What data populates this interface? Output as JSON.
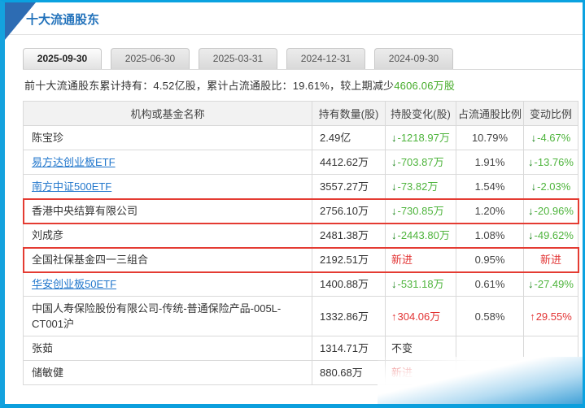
{
  "panel": {
    "title": "十大流通股东"
  },
  "tabs": [
    {
      "label": "2025-09-30",
      "active": true
    },
    {
      "label": "2025-06-30",
      "active": false
    },
    {
      "label": "2025-03-31",
      "active": false
    },
    {
      "label": "2024-12-31",
      "active": false
    },
    {
      "label": "2024-09-30",
      "active": false
    }
  ],
  "summary": {
    "label_holding": "前十大流通股东累计持有：",
    "holding_value": "4.52亿股",
    "label_ratio": "，累计占流通股比：",
    "ratio_value": "19.61%",
    "label_change": "，较上期减少",
    "change_value": "4606.06万股"
  },
  "table": {
    "headers": [
      "机构或基金名称",
      "持有数量(股)",
      "持股变化(股)",
      "占流通股比例",
      "变动比例"
    ],
    "rows": [
      {
        "name": "陈宝珍",
        "is_link": false,
        "quantity": "2.49亿",
        "change": "-1218.97万",
        "change_dir": "down",
        "ratio": "10.79%",
        "variation": "-4.67%",
        "variation_dir": "down",
        "highlighted": false
      },
      {
        "name": "易方达创业板ETF",
        "is_link": true,
        "quantity": "4412.62万",
        "change": "-703.87万",
        "change_dir": "down",
        "ratio": "1.91%",
        "variation": "-13.76%",
        "variation_dir": "down",
        "highlighted": false
      },
      {
        "name": "南方中证500ETF",
        "is_link": true,
        "quantity": "3557.27万",
        "change": "-73.82万",
        "change_dir": "down",
        "ratio": "1.54%",
        "variation": "-2.03%",
        "variation_dir": "down",
        "highlighted": false
      },
      {
        "name": "香港中央结算有限公司",
        "is_link": false,
        "quantity": "2756.10万",
        "change": "-730.85万",
        "change_dir": "down",
        "ratio": "1.20%",
        "variation": "-20.96%",
        "variation_dir": "down",
        "highlighted": true
      },
      {
        "name": "刘成彦",
        "is_link": false,
        "quantity": "2481.38万",
        "change": "-2443.80万",
        "change_dir": "down",
        "ratio": "1.08%",
        "variation": "-49.62%",
        "variation_dir": "down",
        "highlighted": false
      },
      {
        "name": "全国社保基金四一三组合",
        "is_link": false,
        "quantity": "2192.51万",
        "change": "新进",
        "change_dir": "new",
        "ratio": "0.95%",
        "variation": "新进",
        "variation_dir": "new",
        "highlighted": true
      },
      {
        "name": "华安创业板50ETF",
        "is_link": true,
        "quantity": "1400.88万",
        "change": "-531.18万",
        "change_dir": "down",
        "ratio": "0.61%",
        "variation": "-27.49%",
        "variation_dir": "down",
        "highlighted": false
      },
      {
        "name": "中国人寿保险股份有限公司-传统-普通保险产品-005L-CT001沪",
        "is_link": false,
        "quantity": "1332.86万",
        "change": "304.06万",
        "change_dir": "up",
        "ratio": "0.58%",
        "variation": "29.55%",
        "variation_dir": "up",
        "highlighted": false
      },
      {
        "name": "张茹",
        "is_link": false,
        "quantity": "1314.71万",
        "change": "不变",
        "change_dir": "flat",
        "ratio": "",
        "variation": "",
        "variation_dir": "none",
        "highlighted": false
      },
      {
        "name": "储敏健",
        "is_link": false,
        "quantity": "880.68万",
        "change": "新进",
        "change_dir": "new",
        "ratio": "",
        "variation": "",
        "variation_dir": "none",
        "highlighted": false
      }
    ]
  },
  "icons": {
    "down_arrow": "↓",
    "up_arrow": "↑"
  },
  "colors": {
    "frame_blue": "#0aa2e0",
    "corner_navy": "#2d6cb3",
    "title_blue": "#2272bb",
    "link_blue": "#2277cc",
    "decrease_green": "#4eb43c",
    "increase_red": "#e23333",
    "highlight_box_red": "#e43b32"
  }
}
